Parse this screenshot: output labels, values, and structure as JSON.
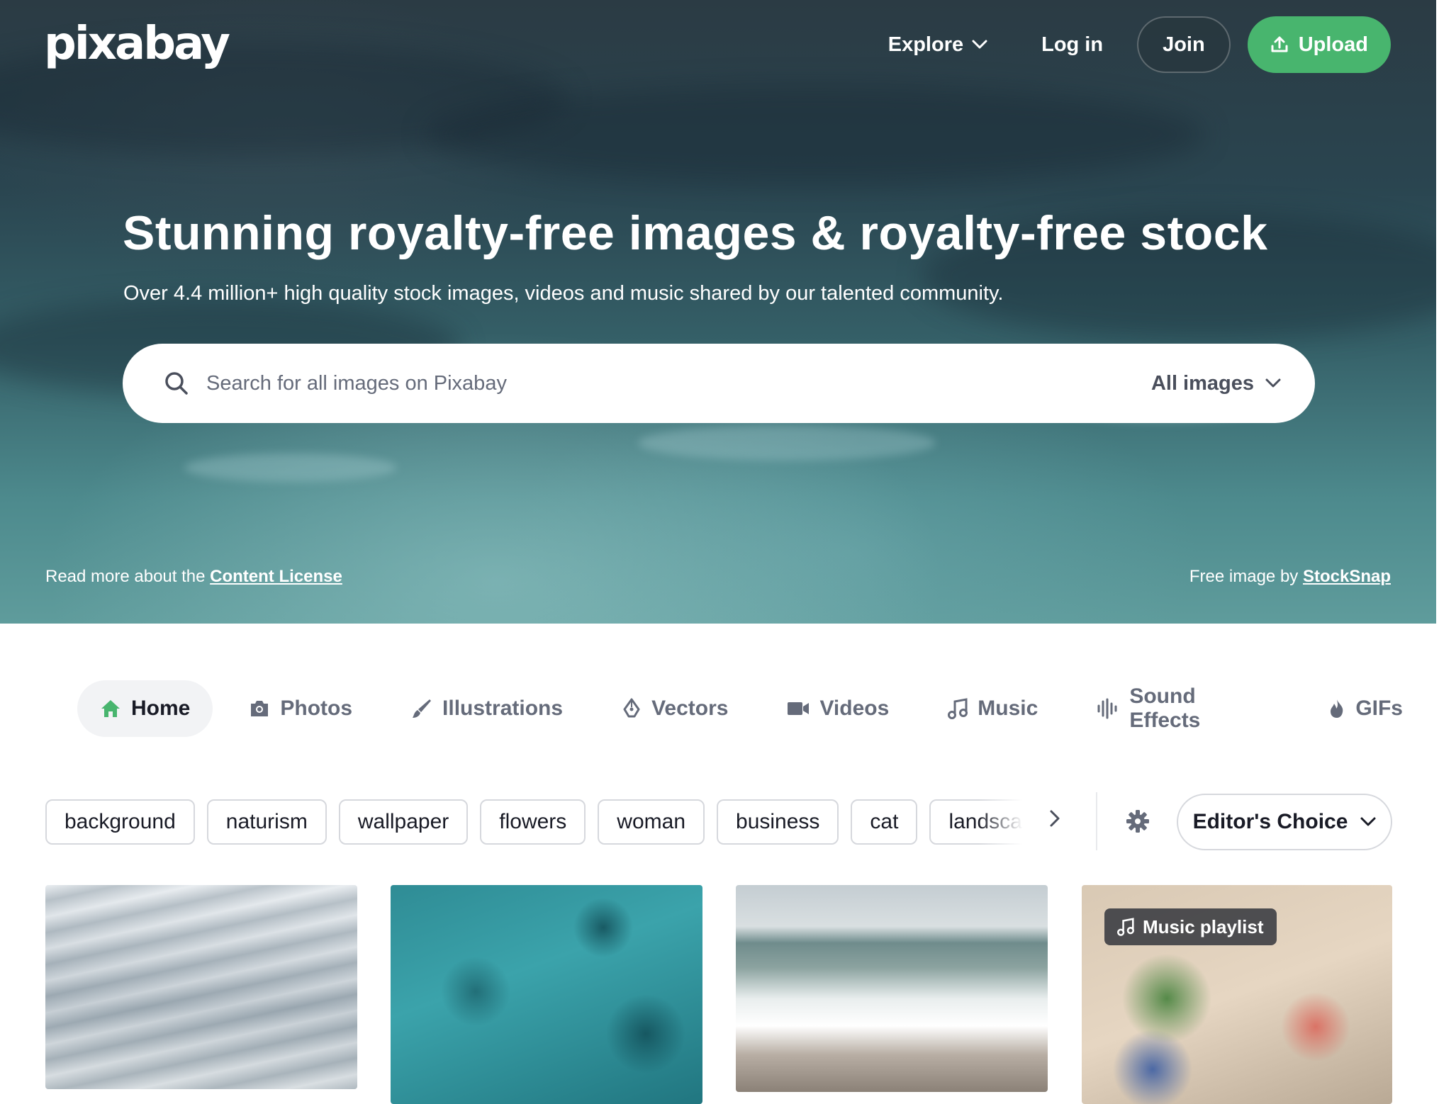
{
  "header": {
    "logo_text": "pixabay",
    "nav": {
      "explore_label": "Explore",
      "login_label": "Log in",
      "join_label": "Join",
      "upload_label": "Upload"
    }
  },
  "hero": {
    "title": "Stunning royalty-free images & royalty-free stock",
    "subtitle": "Over 4.4 million+ high quality stock images, videos and music shared by our talented community.",
    "search": {
      "placeholder": "Search for all images on Pixabay",
      "value": "",
      "type_selected": "All images"
    },
    "license_prefix": "Read more about the ",
    "license_link": "Content License",
    "credit_prefix": "Free image by ",
    "credit_link": "StockSnap"
  },
  "tabs": [
    {
      "label": "Home",
      "icon": "home-icon",
      "active": true
    },
    {
      "label": "Photos",
      "icon": "camera-icon",
      "active": false
    },
    {
      "label": "Illustrations",
      "icon": "brush-icon",
      "active": false
    },
    {
      "label": "Vectors",
      "icon": "pen-nib-icon",
      "active": false
    },
    {
      "label": "Videos",
      "icon": "video-camera-icon",
      "active": false
    },
    {
      "label": "Music",
      "icon": "music-note-icon",
      "active": false
    },
    {
      "label": "Sound Effects",
      "icon": "waveform-icon",
      "active": false
    },
    {
      "label": "GIFs",
      "icon": "flame-icon",
      "active": false
    }
  ],
  "tags": [
    "background",
    "naturism",
    "wallpaper",
    "flowers",
    "woman",
    "business",
    "cat",
    "landscape"
  ],
  "sort": {
    "selected": "Editor's Choice"
  },
  "grid": {
    "cards": [
      {
        "badge": ""
      },
      {
        "badge": ""
      },
      {
        "badge": ""
      },
      {
        "badge": "Music playlist"
      }
    ]
  },
  "colors": {
    "accent_green": "#48b56e",
    "text_dark": "#191b26",
    "text_muted": "#656b7a"
  }
}
